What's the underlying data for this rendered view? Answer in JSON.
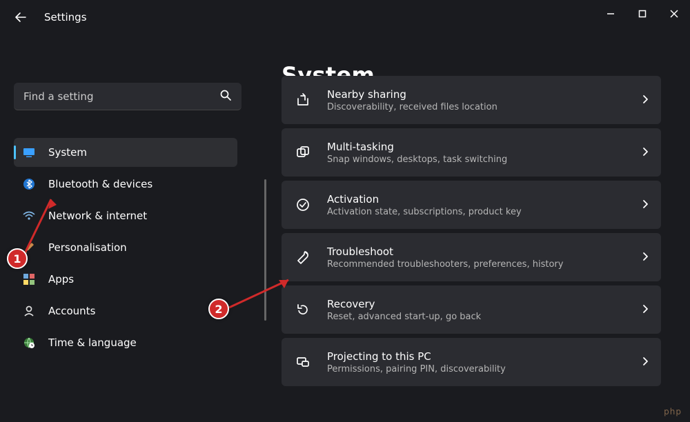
{
  "window": {
    "app_title": "Settings",
    "minimize": "—",
    "maximize": "▢",
    "close": "✕"
  },
  "search": {
    "placeholder": "Find a setting"
  },
  "page": {
    "title": "System"
  },
  "nav": {
    "items": [
      {
        "label": "System"
      },
      {
        "label": "Bluetooth & devices"
      },
      {
        "label": "Network & internet"
      },
      {
        "label": "Personalisation"
      },
      {
        "label": "Apps"
      },
      {
        "label": "Accounts"
      },
      {
        "label": "Time & language"
      }
    ]
  },
  "cards": [
    {
      "title": "Nearby sharing",
      "subtitle": "Discoverability, received files location"
    },
    {
      "title": "Multi-tasking",
      "subtitle": "Snap windows, desktops, task switching"
    },
    {
      "title": "Activation",
      "subtitle": "Activation state, subscriptions, product key"
    },
    {
      "title": "Troubleshoot",
      "subtitle": "Recommended troubleshooters, preferences, history"
    },
    {
      "title": "Recovery",
      "subtitle": "Reset, advanced start-up, go back"
    },
    {
      "title": "Projecting to this PC",
      "subtitle": "Permissions, pairing PIN, discoverability"
    }
  ],
  "annotations": {
    "badge1": "1",
    "badge2": "2"
  },
  "watermark": "php"
}
